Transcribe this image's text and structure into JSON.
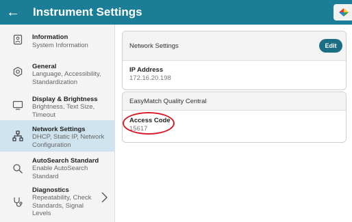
{
  "header": {
    "title": "Instrument Settings",
    "back_icon": "arrow-back-icon",
    "brand_icon": "brand-logo-icon"
  },
  "sidebar": {
    "items": [
      {
        "title": "Information",
        "subtitle": "System Information",
        "icon": "info-badge-icon"
      },
      {
        "title": "General",
        "subtitle": "Language, Accessibility, Standardization",
        "icon": "gear-icon"
      },
      {
        "title": "Display & Brightness",
        "subtitle": "Brightness, Text Size, Timeout",
        "icon": "monitor-icon"
      },
      {
        "title": "Network Settings",
        "subtitle": "DHCP, Static IP, Network Configuration",
        "icon": "network-icon",
        "selected": true
      },
      {
        "title": "AutoSearch Standard",
        "subtitle": "Enable AutoSearch Standard",
        "icon": "search-icon"
      },
      {
        "title": "Diagnostics",
        "subtitle": "Repeatability, Check Standards, Signal Levels",
        "icon": "stethoscope-icon"
      }
    ]
  },
  "main": {
    "network_card": {
      "header": "Network Settings",
      "edit_label": "Edit",
      "ip_label": "IP Address",
      "ip_value": "172.16.20.198"
    },
    "easymatch_card": {
      "header": "EasyMatch Quality Central",
      "access_label": "Access Code",
      "access_value": "15617"
    }
  },
  "colors": {
    "appbar": "#1b7e96",
    "selected": "#cfe4ee",
    "edit_button": "#1b6e84",
    "highlight": "#d81b2b"
  }
}
